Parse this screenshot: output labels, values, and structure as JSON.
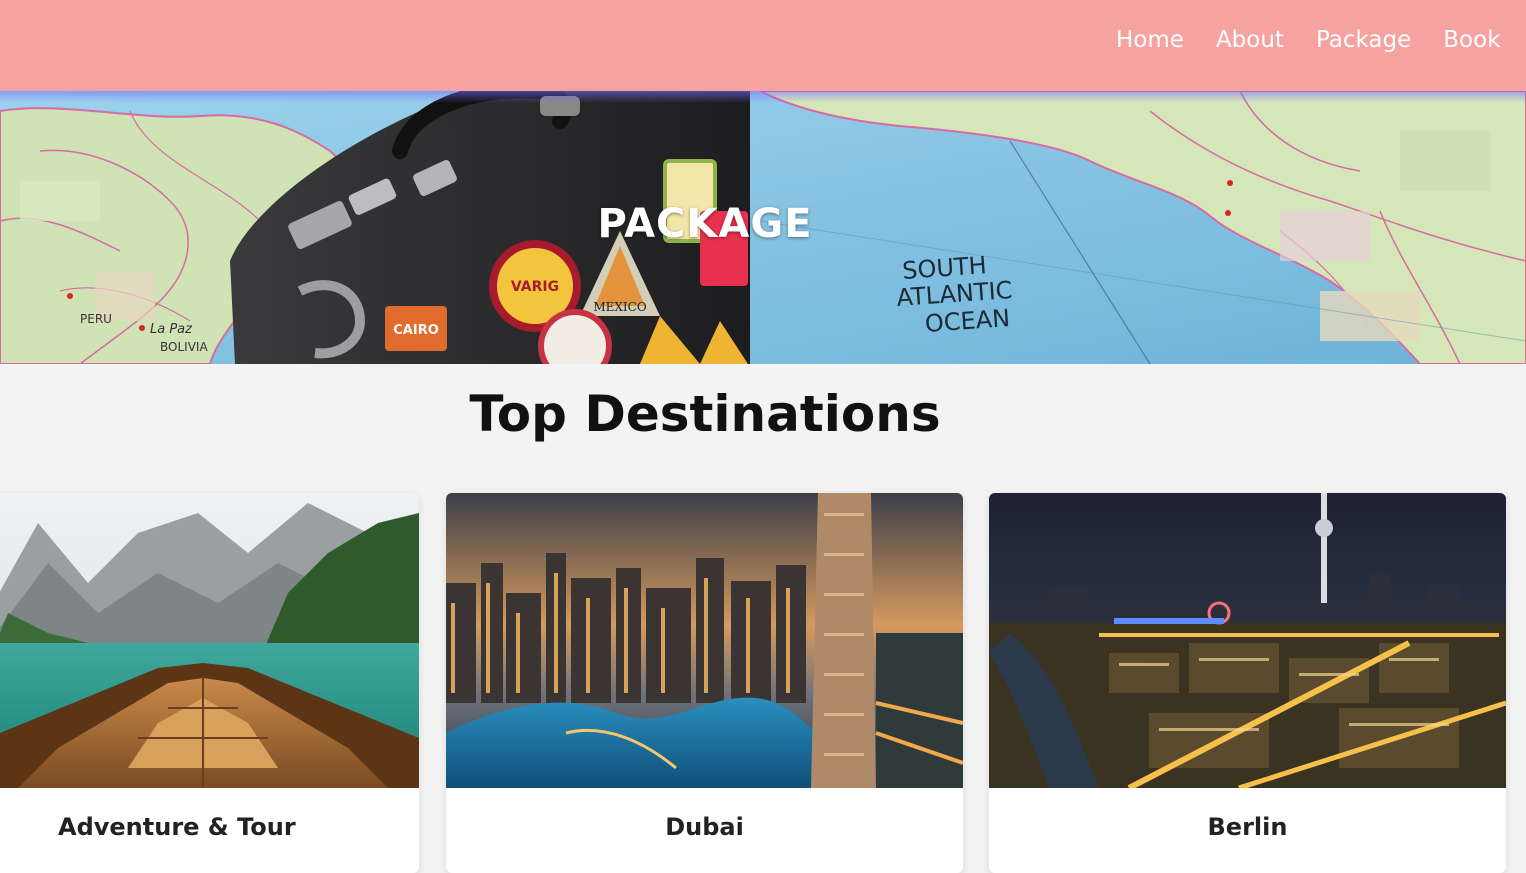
{
  "nav": {
    "items": [
      {
        "label": "Home"
      },
      {
        "label": "About"
      },
      {
        "label": "Package"
      },
      {
        "label": "Book"
      }
    ]
  },
  "hero": {
    "title": "PACKAGE",
    "map_labels": {
      "ocean": [
        "SOUTH",
        "ATLANTIC",
        "OCEAN"
      ],
      "city": "La Paz",
      "country": "BOLIVIA",
      "country2": "PERU"
    },
    "stickers": [
      "CAIRO",
      "MEXICO",
      "VARIG"
    ]
  },
  "section": {
    "title": "Top Destinations"
  },
  "cards": [
    {
      "title": "Adventure & Tour"
    },
    {
      "title": "Dubai"
    },
    {
      "title": "Berlin"
    }
  ],
  "colors": {
    "nav_bg": "#f6a2a0",
    "page_bg": "#f3f3f3",
    "nav_text": "#ffffff"
  }
}
